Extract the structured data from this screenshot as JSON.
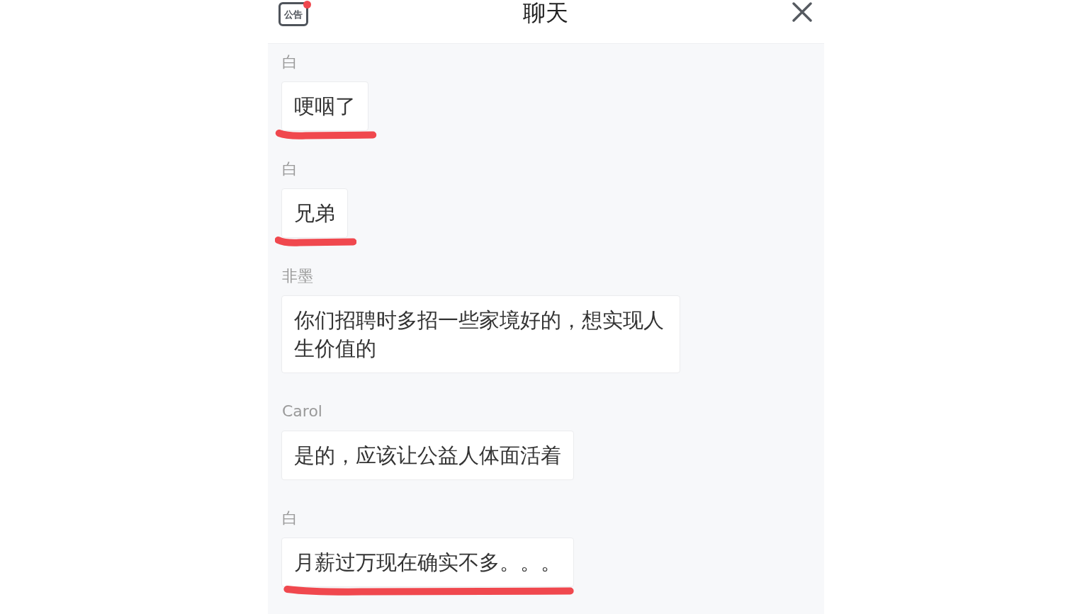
{
  "header": {
    "announcement": {
      "label": "公告",
      "unread": true
    },
    "title": "聊天"
  },
  "messages": [
    {
      "sender": "白",
      "text": "哽咽了",
      "underlined": true
    },
    {
      "sender": "白",
      "text": "兄弟",
      "underlined": true
    },
    {
      "sender": "非墨",
      "text": "你们招聘时多招一些家境好的，想实现人生价值的",
      "underlined": false
    },
    {
      "sender": "Carol",
      "text": "是的，应该让公益人体面活着",
      "underlined": false
    },
    {
      "sender": "白",
      "text": "月薪过万现在确实不多。。。",
      "underlined": true
    }
  ]
}
